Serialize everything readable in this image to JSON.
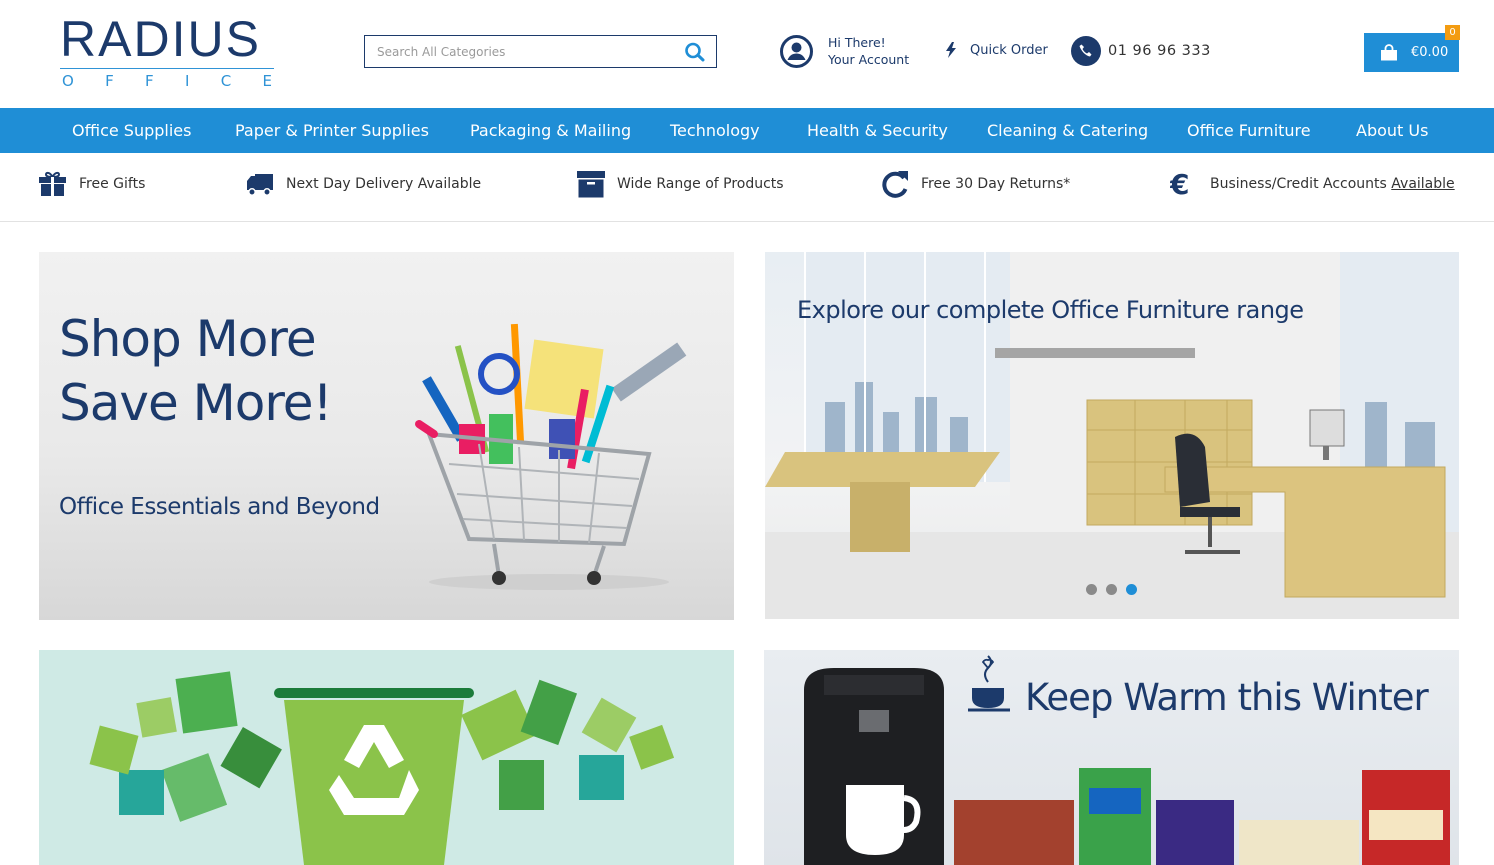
{
  "logo": {
    "main": "RADIUS",
    "sub": [
      "O",
      "F",
      "F",
      "I",
      "C",
      "E"
    ]
  },
  "search": {
    "placeholder": "Search All Categories"
  },
  "account": {
    "greeting": "Hi There!",
    "label": "Your Account"
  },
  "quick_order": "Quick Order",
  "phone": "01 96 96 333",
  "cart": {
    "total": "€0.00",
    "count": "0"
  },
  "nav": [
    "Office Supplies",
    "Paper & Printer Supplies",
    "Packaging & Mailing",
    "Technology",
    "Health & Security",
    "Cleaning & Catering",
    "Office Furniture",
    "About Us"
  ],
  "usp": {
    "free_gifts": "Free Gifts",
    "delivery": "Next Day Delivery Available",
    "range": "Wide Range of Products",
    "returns": "Free 30 Day Returns*",
    "accounts": "Business/Credit Accounts",
    "accounts_link": "Available"
  },
  "banners": {
    "shop_line1": "Shop More",
    "shop_line2": "Save More!",
    "shop_sub": "Office Essentials and Beyond",
    "furniture_title": "Explore our complete Office Furniture range",
    "winter_title": "Keep Warm this Winter"
  },
  "colors": {
    "brand_navy": "#1c3a6b",
    "brand_blue": "#1f8ed6",
    "badge": "#f39c12"
  },
  "carousel": {
    "slides": 3,
    "active": 3
  }
}
